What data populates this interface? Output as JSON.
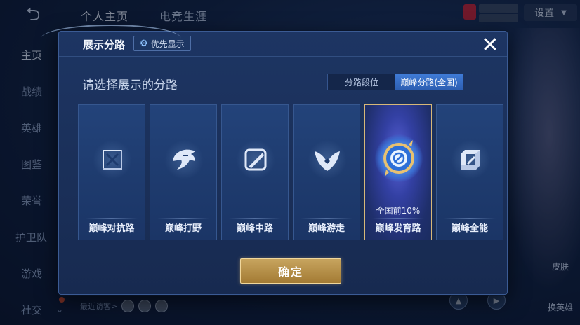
{
  "background": {
    "back_icon": "back-arrow-icon",
    "top_tabs": [
      "个人主页",
      "电竞生涯"
    ],
    "settings_label": "设置",
    "sidebar": [
      {
        "label": "主页",
        "chevron": false
      },
      {
        "label": "战绩",
        "chevron": false
      },
      {
        "label": "英雄",
        "chevron": false
      },
      {
        "label": "图鉴",
        "chevron": true
      },
      {
        "label": "荣誉",
        "chevron": true
      },
      {
        "label": "护卫队",
        "chevron": true
      },
      {
        "label": "游戏",
        "chevron": true
      },
      {
        "label": "社交",
        "chevron": true
      }
    ],
    "recent_visitors_label": "最近访客>",
    "side_labels": [
      "皮肤",
      "换英雄"
    ]
  },
  "modal": {
    "title": "展示分路",
    "priority_label": "优先显示",
    "priority_icon": "gear-icon",
    "close_icon": "close-icon",
    "prompt": "请选择展示的分路",
    "toggle": {
      "options": [
        "分路段位",
        "巅峰分路(全国)"
      ],
      "active_index": 1
    },
    "lanes": [
      {
        "name": "巅峰对抗路",
        "icon": "clash-lane-icon"
      },
      {
        "name": "巅峰打野",
        "icon": "jungle-dragon-icon"
      },
      {
        "name": "巅峰中路",
        "icon": "mid-lane-icon"
      },
      {
        "name": "巅峰游走",
        "icon": "roam-wings-icon"
      },
      {
        "name": "巅峰发育路",
        "icon": "farm-lane-badge-icon",
        "rank": "全国前10%",
        "selected": true
      },
      {
        "name": "巅峰全能",
        "icon": "all-round-icon"
      }
    ],
    "confirm_label": "确定"
  },
  "colors": {
    "accent_blue": "#2d5fb3",
    "confirm_gold": "#c7a45e",
    "selected_border": "#d7b878"
  }
}
